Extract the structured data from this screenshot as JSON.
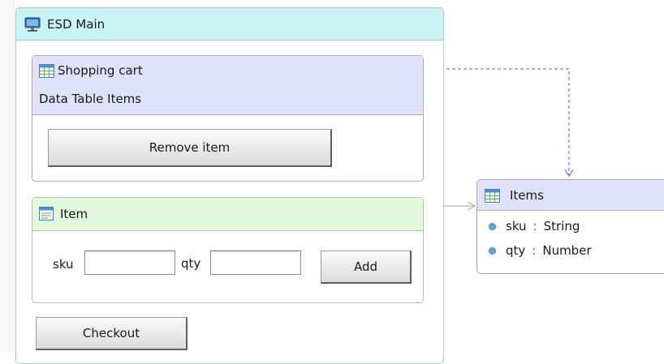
{
  "main": {
    "title": "ESD Main",
    "icon": "monitor-icon"
  },
  "cart_panel": {
    "title": "Shopping cart",
    "subtitle": "Data Table Items",
    "icon": "table-icon",
    "remove_button": "Remove item"
  },
  "item_panel": {
    "title": "Item",
    "icon": "form-icon",
    "sku_label": "sku",
    "sku_value": "",
    "qty_label": "qty",
    "qty_value": "",
    "add_button": "Add"
  },
  "checkout_button": "Checkout",
  "entity": {
    "title": "Items",
    "icon": "table-icon",
    "fields": [
      {
        "name": "sku",
        "sep": ":",
        "type": "String"
      },
      {
        "name": "qty",
        "sep": ":",
        "type": "Number"
      }
    ]
  },
  "colors": {
    "main_header": "#c9f4f6",
    "cart_header": "#e1e1fa",
    "item_header": "#e3f9de",
    "dashed_link": "#5a5ae6",
    "field_dot": "#5fa7d8"
  }
}
